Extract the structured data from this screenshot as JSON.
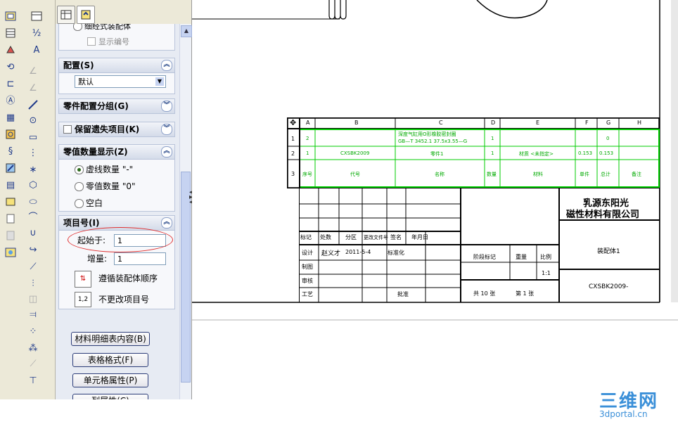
{
  "panel": {
    "tabs": [
      "feature-tree-tab",
      "property-tab"
    ],
    "top_partial": {
      "radio_label": "细经式装配体",
      "checkbox_label": "显示编号"
    },
    "config": {
      "title": "配置(S)",
      "value": "默认"
    },
    "part_config_group": {
      "title": "零件配置分组(G)"
    },
    "keep_missing": {
      "title": "保留遗失项目(K)"
    },
    "zero_qty": {
      "title": "零值数量显示(Z)",
      "options": [
        "虚线数量 \"-\"",
        "零值数量 \"0\"",
        "空白"
      ],
      "selected": 0
    },
    "item_no": {
      "title": "项目号(I)",
      "start_label": "起始于:",
      "start_value": "1",
      "increment_label": "增量:",
      "increment_value": "1",
      "follow_order_label": "遵循装配体顺序",
      "no_change_label": "不更改项目号"
    },
    "buttons": [
      "材料明细表内容(B)",
      "表格格式(F)",
      "单元格属性(P)",
      "列属性(C)"
    ]
  },
  "bom_table": {
    "columns": [
      "A",
      "B",
      "C",
      "D",
      "E",
      "F",
      "G",
      "H"
    ],
    "rows": [
      {
        "num": "1",
        "cells": [
          "2",
          "",
          "深度气缸用O形橡胶密封圈\nGB—T 3452.1 37.5x3.55—G",
          "1",
          "",
          "",
          "0",
          ""
        ]
      },
      {
        "num": "2",
        "cells": [
          "1",
          "CXSBK2009",
          "零件1",
          "1",
          "材质 <未指定>",
          "0.153",
          "0.153",
          ""
        ]
      },
      {
        "num": "3",
        "cells": [
          "序号",
          "代号",
          "名称",
          "数量",
          "材料",
          "单件",
          "总计",
          "备注"
        ]
      }
    ]
  },
  "title_block": {
    "company_line1": "乳源东阳光",
    "company_line2": "磁性材料有限公司",
    "drawing_name": "装配体1",
    "drawing_code": "CXSBK2009-",
    "header_labels": [
      "标记",
      "处数",
      "分区",
      "更改文件号",
      "签名",
      "年月日"
    ],
    "row_labels": [
      "设计",
      "制图",
      "审核",
      "工艺"
    ],
    "designer": "赵义才",
    "date": "2011-5-4",
    "standardized": "标准化",
    "approval": "批准",
    "stage_label": "阶段标记",
    "weight_label": "重量",
    "scale_label": "比例",
    "scale_value": "1:1",
    "sheet_total": "共 10 张",
    "sheet_num": "第 1 张"
  },
  "watermark": {
    "text": "三维网",
    "url": "3dportal.cn"
  },
  "colors": {
    "panel_bg": "#e7ebf3",
    "toolbar_bg": "#ece9d8",
    "bom_green": "#00cc00",
    "highlight_red": "#e03030"
  }
}
